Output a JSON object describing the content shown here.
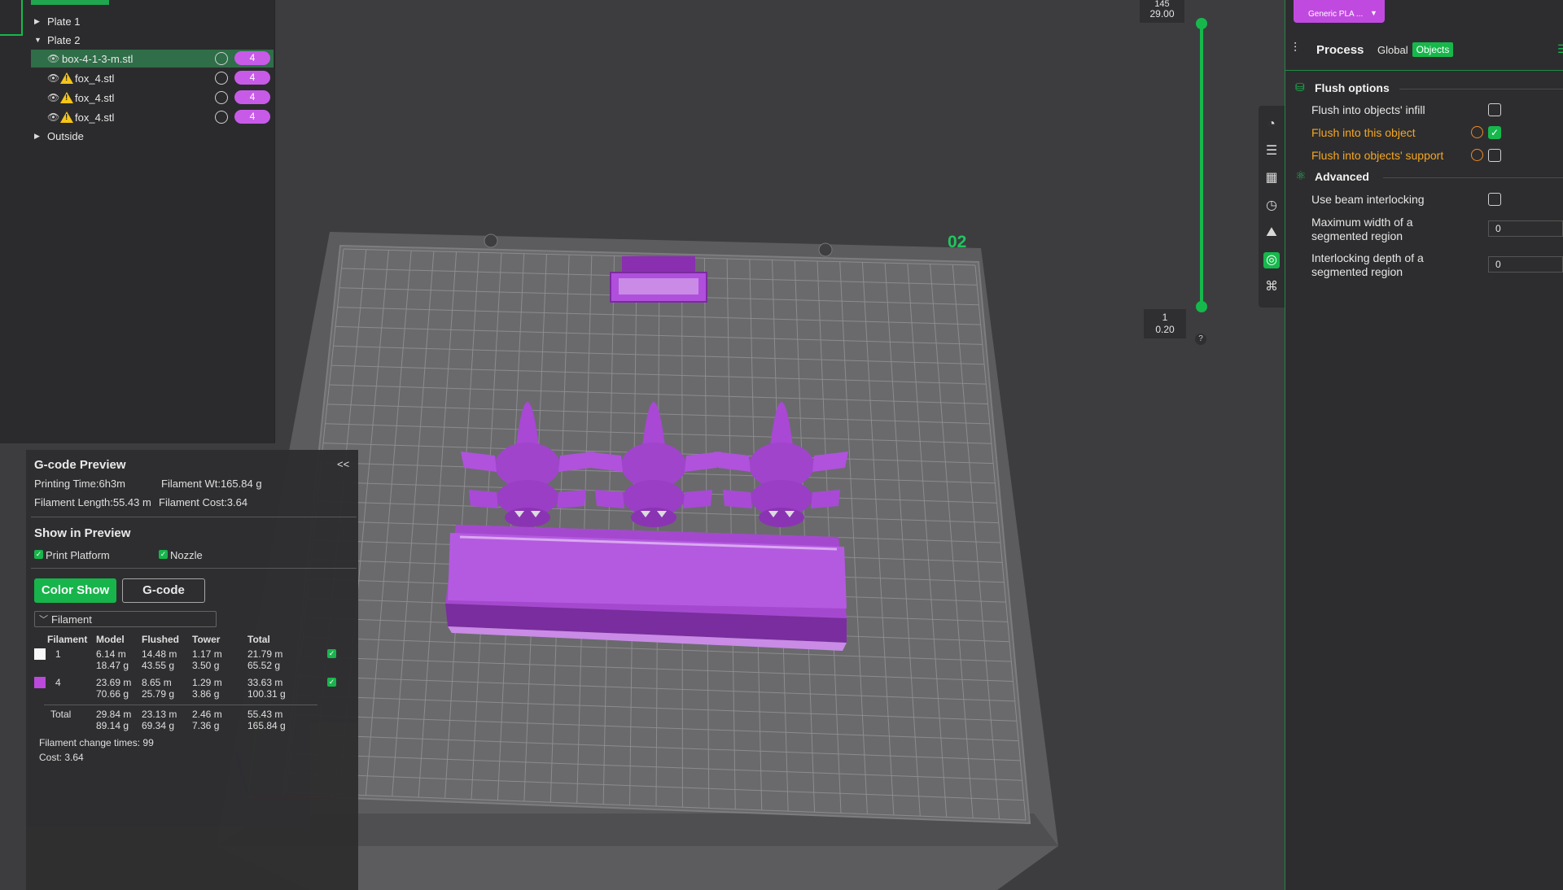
{
  "object_tree": {
    "items": [
      {
        "label": "Plate 1",
        "expanded": false
      },
      {
        "label": "Plate 2",
        "expanded": true
      },
      {
        "label": "box-4-1-3-m.stl",
        "filament": "4",
        "warning": false
      },
      {
        "label": "fox_4.stl",
        "filament": "4",
        "warning": true
      },
      {
        "label": "fox_4.stl",
        "filament": "4",
        "warning": true
      },
      {
        "label": "fox_4.stl",
        "filament": "4",
        "warning": true
      },
      {
        "label": "Outside",
        "expanded": false
      }
    ]
  },
  "viewport": {
    "plate_number": "02",
    "layer_slider": {
      "top_layer": "145",
      "top_height": "29.00",
      "bottom_layer": "1",
      "bottom_height": "0.20",
      "help": "?"
    }
  },
  "gcode_preview": {
    "title": "G-code Preview",
    "collapse": "<<",
    "printing_time": "Printing Time:6h3m",
    "filament_wt": "Filament Wt:165.84 g",
    "filament_length": "Filament Length:55.43 m",
    "filament_cost": "Filament Cost:3.64",
    "show_in_preview": "Show in Preview",
    "print_platform": "Print Platform",
    "nozzle": "Nozzle",
    "color_show": "Color Show",
    "gcode_button": "G-code",
    "filament_dropdown": "Filament",
    "table": {
      "headers": [
        "Filament",
        "Model",
        "Flushed",
        "Tower",
        "Total"
      ],
      "rows": [
        {
          "id": "1",
          "color": "#ffffff",
          "model": [
            "6.14 m",
            "18.47 g"
          ],
          "flushed": [
            "14.48 m",
            "43.55 g"
          ],
          "tower": [
            "1.17 m",
            "3.50 g"
          ],
          "total": [
            "21.79 m",
            "65.52 g"
          ]
        },
        {
          "id": "4",
          "color": "#c04ae0",
          "model": [
            "23.69 m",
            "70.66 g"
          ],
          "flushed": [
            "8.65 m",
            "25.79 g"
          ],
          "tower": [
            "1.29 m",
            "3.86 g"
          ],
          "total": [
            "33.63 m",
            "100.31 g"
          ]
        }
      ],
      "total": {
        "label": "Total",
        "model": [
          "29.84 m",
          "89.14 g"
        ],
        "flushed": [
          "23.13 m",
          "69.34 g"
        ],
        "tower": [
          "2.46 m",
          "7.36 g"
        ],
        "total": [
          "55.43 m",
          "165.84 g"
        ]
      }
    },
    "change_times": "Filament change times:  99",
    "cost": "Cost:  3.64"
  },
  "side_toolbar": {
    "icons": [
      "quality-icon",
      "strength-icon",
      "support-icon",
      "speed-icon",
      "multimaterial-icon",
      "others-icon",
      "command-icon"
    ]
  },
  "right_panel": {
    "filament_chip": "Generic PLA ...",
    "process_title": "Process",
    "tab_global": "Global",
    "tab_objects": "Objects",
    "flush_section": "Flush options",
    "flush_infill": "Flush into objects' infill",
    "flush_object": "Flush into this object",
    "flush_support": "Flush into objects' support",
    "advanced_section": "Advanced",
    "beam_interlocking": "Use beam interlocking",
    "max_width": "Maximum width of a segmented region",
    "max_width_value": "0",
    "interlock_depth": "Interlocking depth of a segmented region",
    "interlock_depth_value": "0"
  }
}
